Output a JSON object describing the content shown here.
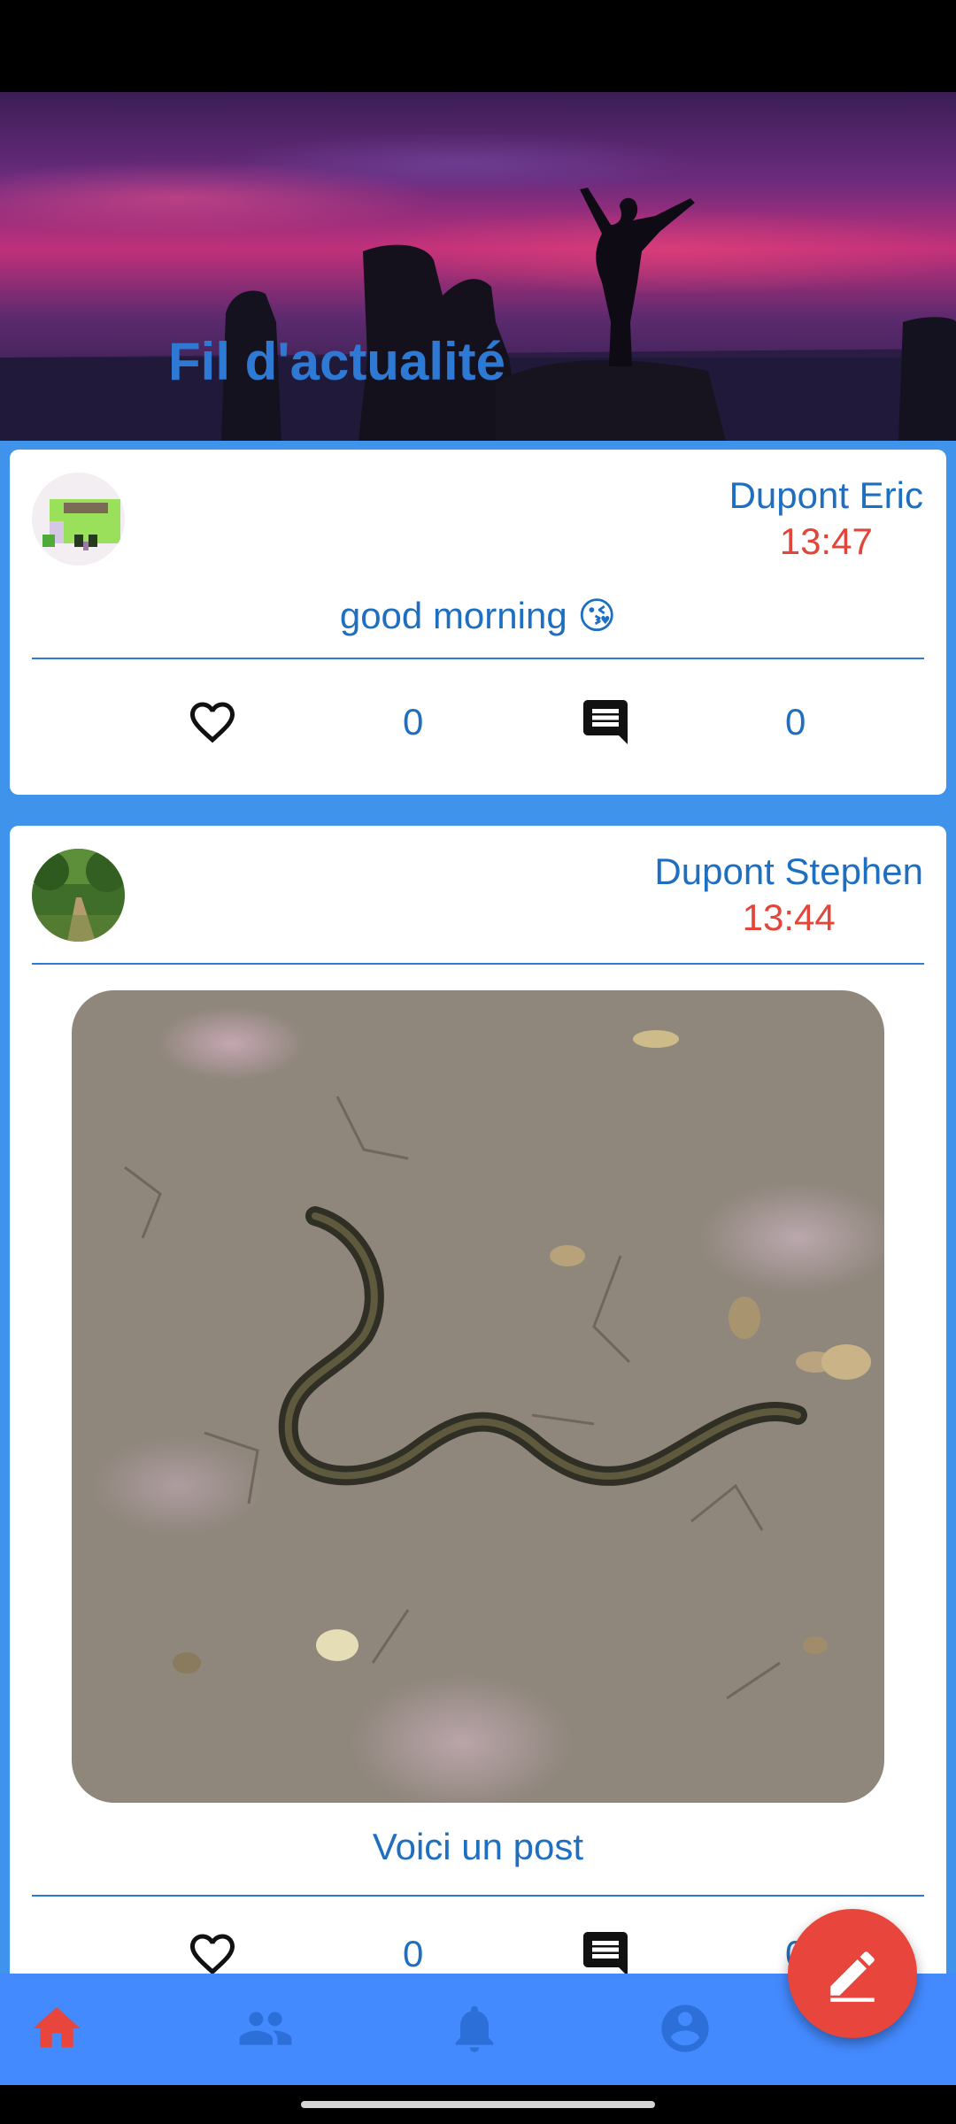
{
  "header": {
    "title": "Fil d'actualité"
  },
  "posts": [
    {
      "author": "Dupont Eric",
      "time": "13:47",
      "text": "good morning 😘",
      "likes": "0",
      "comments": "0"
    },
    {
      "author": "Dupont Stephen",
      "time": "13:44",
      "text": "Voici un post",
      "likes": "0",
      "comments": "0",
      "has_image": true
    }
  ],
  "fab": {
    "icon": "edit-icon"
  },
  "bottom_nav": [
    {
      "icon": "home-icon",
      "active": true
    },
    {
      "icon": "people-icon"
    },
    {
      "icon": "bell-icon"
    },
    {
      "icon": "account-icon"
    }
  ],
  "colors": {
    "primary": "#448aff",
    "accent": "#e8453c",
    "text_blue": "#1f6fc1",
    "time_red": "#e2463a",
    "feed_bg": "#3f93ea"
  }
}
